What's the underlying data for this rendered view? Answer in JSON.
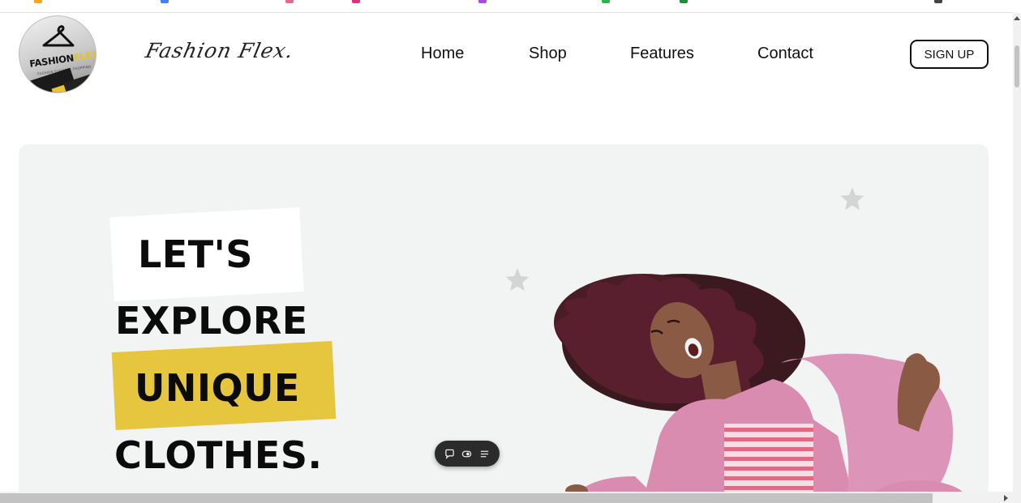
{
  "header": {
    "logo": {
      "brand_main": "FASHION",
      "brand_accent": "FLEX",
      "tagline": "FASHION FLEXIBLE SHOPPING",
      "icon": "hanger-icon"
    },
    "script_title": "Fashion Flex.",
    "nav": [
      "Home",
      "Shop",
      "Features",
      "Contact"
    ],
    "signup_label": "SIGN UP"
  },
  "hero": {
    "lines": [
      "LET'S",
      "EXPLORE",
      "UNIQUE",
      "CLOTHES."
    ],
    "highlight_colors": {
      "white_box": "#ffffff",
      "yellow_box": "#e6c53f"
    },
    "background": "#f2f4f3",
    "image": "woman-dancing-pink-fur-coat-photo",
    "decorations": [
      "star-icon",
      "star-icon"
    ]
  },
  "floating_toolbar": {
    "icons": [
      "comment-icon",
      "eye-toggle-icon",
      "menu-list-icon"
    ]
  },
  "colors": {
    "accent_yellow": "#e6c53f",
    "text": "#111111"
  }
}
